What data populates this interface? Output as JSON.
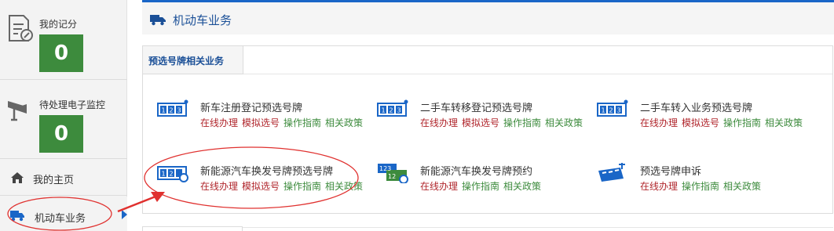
{
  "sidebar": {
    "stats": [
      {
        "label": "我的记分",
        "count": "0",
        "icon": "scorecard-icon"
      },
      {
        "label": "待处理电子监控",
        "count": "0",
        "icon": "camera-icon"
      }
    ],
    "nav": [
      {
        "label": "我的主页",
        "icon": "home-icon"
      },
      {
        "label": "机动车业务",
        "icon": "truck-icon"
      }
    ]
  },
  "main": {
    "header_title": "机动车业务",
    "tab_label": "预选号牌相关业务",
    "services": [
      {
        "title": "新车注册登记预选号牌",
        "links": [
          "在线办理",
          "模拟选号",
          "操作指南",
          "相关政策"
        ]
      },
      {
        "title": "二手车转移登记预选号牌",
        "links": [
          "在线办理",
          "模拟选号",
          "操作指南",
          "相关政策"
        ]
      },
      {
        "title": "二手车转入业务预选号牌",
        "links": [
          "在线办理",
          "模拟选号",
          "操作指南",
          "相关政策"
        ]
      },
      {
        "title": "新能源汽车换发号牌预选号牌",
        "links": [
          "在线办理",
          "模拟选号",
          "操作指南",
          "相关政策"
        ]
      },
      {
        "title": "新能源汽车换发号牌预约",
        "links": [
          "在线办理",
          "操作指南",
          "相关政策"
        ]
      },
      {
        "title": "预选号牌申诉",
        "links": [
          "在线办理",
          "操作指南",
          "相关政策"
        ]
      }
    ]
  },
  "colors": {
    "accent": "#1a66c7",
    "badge": "#3d8b3d",
    "link_red": "#b0262c",
    "link_green": "#3d8b3d",
    "annotation": "#e0312f"
  }
}
